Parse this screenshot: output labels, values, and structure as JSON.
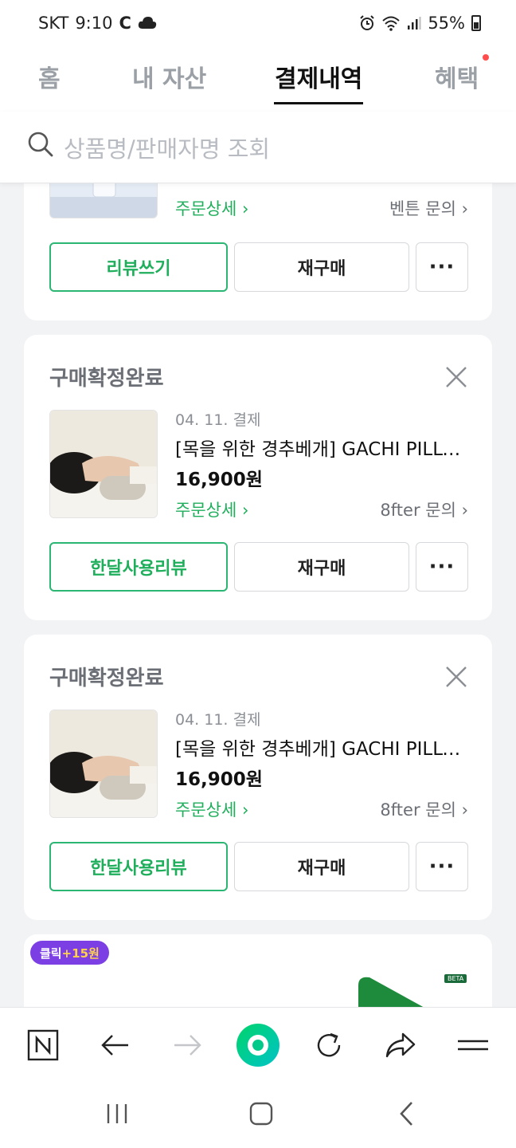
{
  "status_bar": {
    "carrier": "SKT",
    "time": "9:10",
    "battery": "55%"
  },
  "tabs": [
    {
      "label": "홈",
      "active": false
    },
    {
      "label": "내 자산",
      "active": false
    },
    {
      "label": "결제내역",
      "active": true
    },
    {
      "label": "혜택",
      "active": false,
      "has_notification": true
    }
  ],
  "search": {
    "placeholder": "상품명/판매자명 조회"
  },
  "orders": [
    {
      "partial": true,
      "order_detail": "주문상세",
      "seller_inquiry": "벤튼 문의",
      "buttons": {
        "primary": "리뷰쓰기",
        "secondary": "재구매",
        "more": "···"
      }
    },
    {
      "status": "구매확정완료",
      "date": "04. 11. 결제",
      "product_title": "[목을 위한 경추베개] GACHI PILLOW",
      "price": "16,900원",
      "order_detail": "주문상세",
      "seller_inquiry": "8fter 문의",
      "buttons": {
        "primary": "한달사용리뷰",
        "secondary": "재구매",
        "more": "···"
      }
    },
    {
      "status": "구매확정완료",
      "date": "04. 11. 결제",
      "product_title": "[목을 위한 경추베개] GACHI PILLOW",
      "price": "16,900원",
      "order_detail": "주문상세",
      "seller_inquiry": "8fter 문의",
      "buttons": {
        "primary": "한달사용리뷰",
        "secondary": "재구매",
        "more": "···"
      }
    }
  ],
  "ad": {
    "badge_prefix": "클릭",
    "badge_bonus": "+15원",
    "beta_tag": "BETA"
  },
  "toolbar": {
    "icons": [
      "naver-n-icon",
      "back-arrow-icon",
      "forward-arrow-icon",
      "home-green-circle-icon",
      "refresh-icon",
      "share-icon",
      "menu-icon"
    ]
  },
  "colors": {
    "accent_green": "#1fae5b",
    "badge_purple": "#7b3fe4",
    "notification_red": "#ff4d4d"
  }
}
